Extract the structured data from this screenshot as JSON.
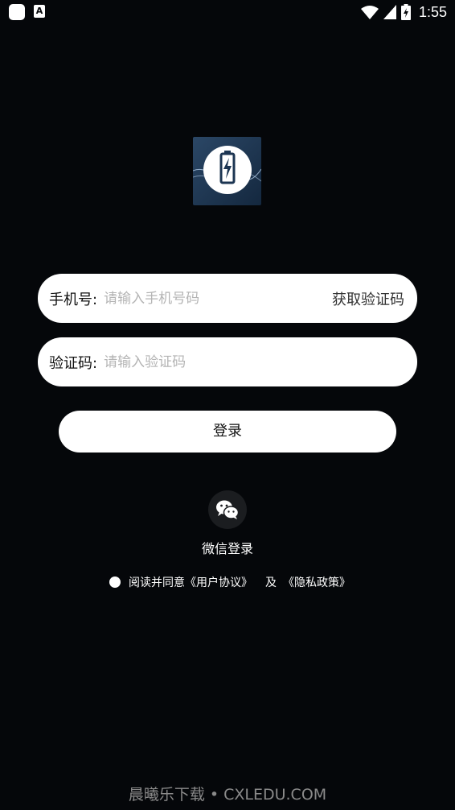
{
  "status_bar": {
    "time": "1:55",
    "app_icon_letter": "A"
  },
  "form": {
    "phone_label": "手机号:",
    "phone_placeholder": "请输入手机号码",
    "get_code_label": "获取验证码",
    "code_label": "验证码:",
    "code_placeholder": "请输入验证码"
  },
  "login_button": "登录",
  "wechat_login": "微信登录",
  "agreement": {
    "prefix": "阅读并同意",
    "user_agreement": "《用户协议》",
    "and": "及",
    "privacy_policy": "《隐私政策》"
  },
  "watermark": "晨曦乐下载 • CXLEDU.COM",
  "colors": {
    "background": "#05070a",
    "field": "#ffffff",
    "placeholder": "#b4b4b4"
  }
}
